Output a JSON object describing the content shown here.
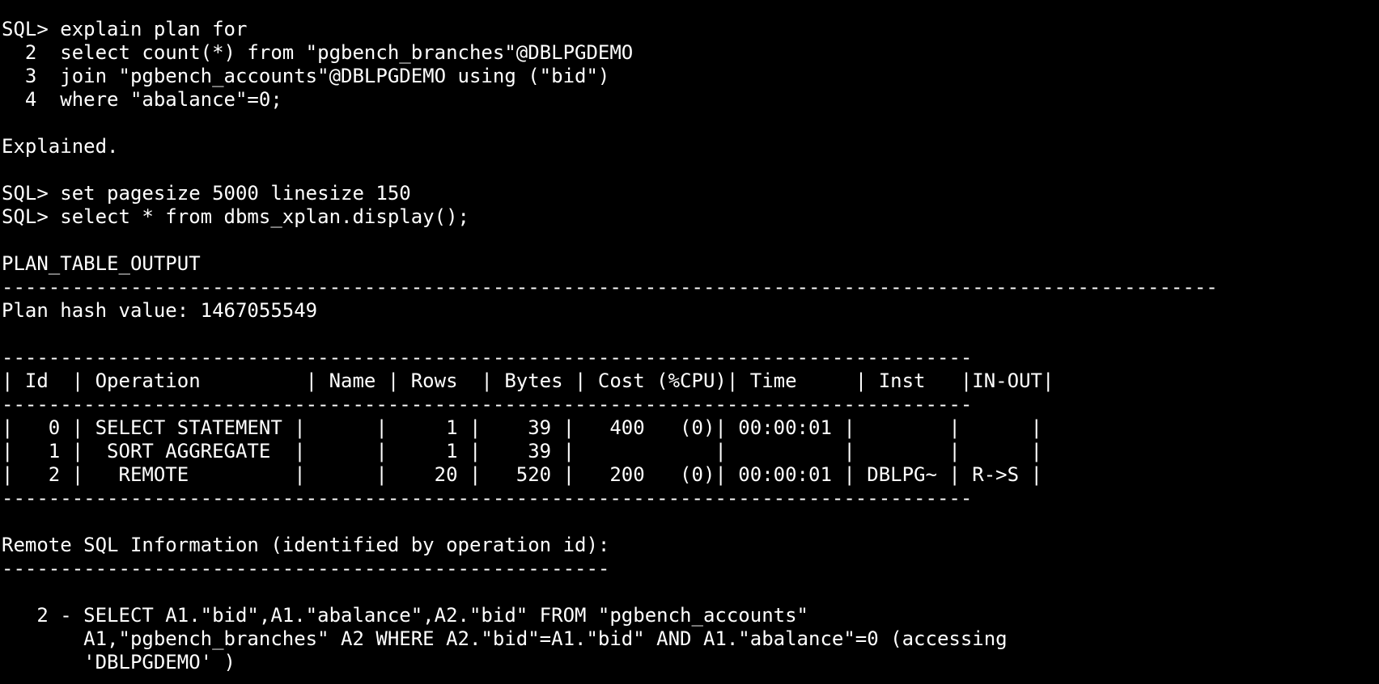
{
  "terminal": {
    "background": "#000000",
    "foreground": "#ffffff",
    "lines": [
      "SQL> explain plan for",
      "  2  select count(*) from \"pgbench_branches\"@DBLPGDEMO",
      "  3  join \"pgbench_accounts\"@DBLPGDEMO using (\"bid\")",
      "  4  where \"abalance\"=0;",
      "",
      "Explained.",
      "",
      "SQL> set pagesize 5000 linesize 150",
      "SQL> select * from dbms_xplan.display();",
      "",
      "PLAN_TABLE_OUTPUT",
      "--------------------------------------------------------------------------------------------------------",
      "Plan hash value: 1467055549",
      "",
      "-----------------------------------------------------------------------------------",
      "| Id  | Operation         | Name | Rows  | Bytes | Cost (%CPU)| Time     | Inst   |IN-OUT|",
      "-----------------------------------------------------------------------------------",
      "|   0 | SELECT STATEMENT |      |     1 |    39 |   400   (0)| 00:00:01 |        |      |",
      "|   1 |  SORT AGGREGATE  |      |     1 |    39 |            |          |        |      |",
      "|   2 |   REMOTE         |      |    20 |   520 |   200   (0)| 00:00:01 | DBLPG~ | R->S |",
      "-----------------------------------------------------------------------------------",
      "",
      "Remote SQL Information (identified by operation id):",
      "----------------------------------------------------",
      "",
      "   2 - SELECT A1.\"bid\",A1.\"abalance\",A2.\"bid\" FROM \"pgbench_accounts\"",
      "       A1,\"pgbench_branches\" A2 WHERE A2.\"bid\"=A1.\"bid\" AND A1.\"abalance\"=0 (accessing",
      "       'DBLPGDEMO' )"
    ]
  }
}
